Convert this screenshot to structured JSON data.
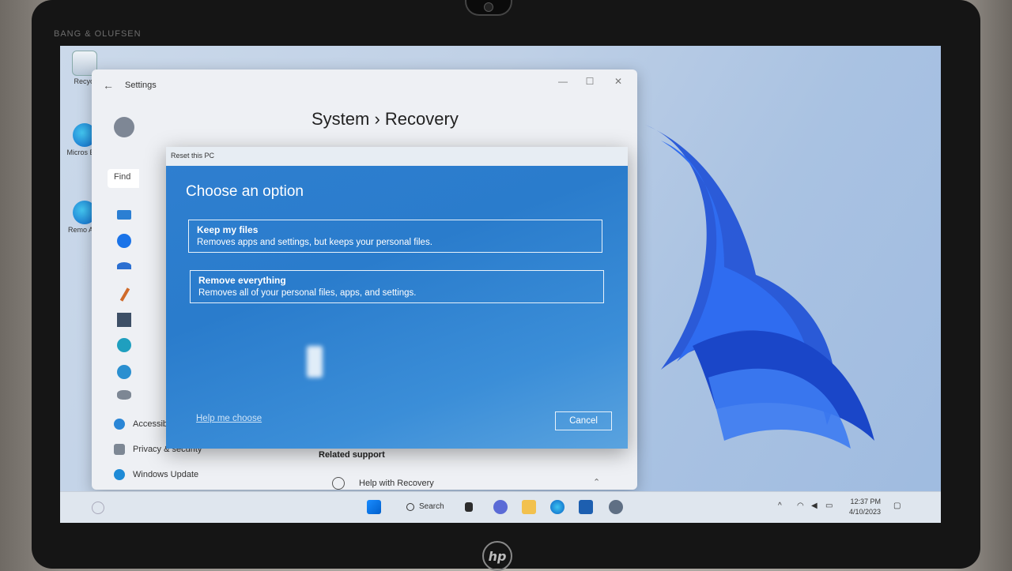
{
  "device": {
    "brand_label": "BANG & OLUFSEN",
    "maker_logo": "hp"
  },
  "desktop": {
    "icons": [
      {
        "name": "recycle-bin",
        "label": "Recycl"
      },
      {
        "name": "microsoft-edge",
        "label": "Micros Edg"
      },
      {
        "name": "remote-app",
        "label": "Remo App"
      }
    ]
  },
  "settings": {
    "window_title": "Settings",
    "page_title": "System  ›  Recovery",
    "find_placeholder": "Find",
    "crumb_right": "overy",
    "nav": [
      {
        "label": "Accessibility"
      },
      {
        "label": "Privacy & security"
      },
      {
        "label": "Windows Update"
      }
    ],
    "related_support": "Related support",
    "help_with_recovery": "Help with Recovery"
  },
  "dialog": {
    "title": "Reset this PC",
    "heading": "Choose an option",
    "options": [
      {
        "title": "Keep my files",
        "description": "Removes apps and settings, but keeps your personal files."
      },
      {
        "title": "Remove everything",
        "description": "Removes all of your personal files, apps, and settings."
      }
    ],
    "help_link": "Help me choose",
    "cancel": "Cancel"
  },
  "taskbar": {
    "search_label": "Search",
    "time": "12:37 PM",
    "date": "4/10/2023"
  },
  "colors": {
    "dialog_blue": "#2f7fd0",
    "accent": "#0067c0"
  }
}
